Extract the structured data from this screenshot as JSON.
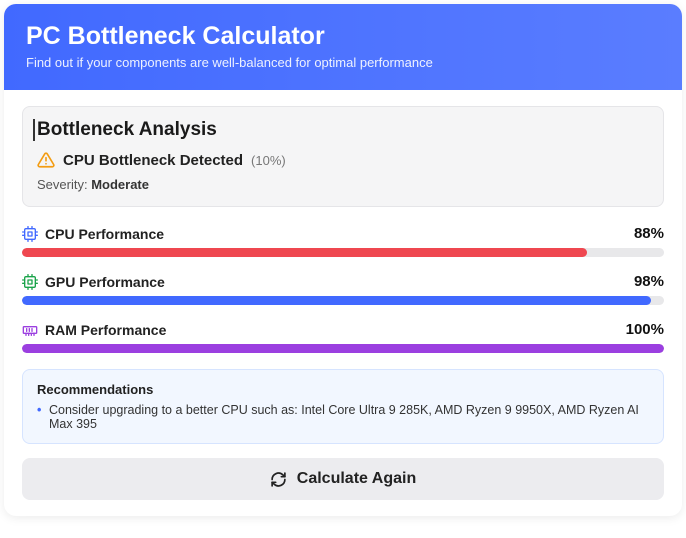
{
  "header": {
    "title": "PC Bottleneck Calculator",
    "subtitle": "Find out if your components are well-balanced for optimal performance"
  },
  "analysis": {
    "heading": "Bottleneck Analysis",
    "detected_label": "CPU Bottleneck Detected",
    "detected_pct": "(10%)",
    "severity_label": "Severity:",
    "severity_value": "Moderate"
  },
  "perf": {
    "cpu": {
      "label": "CPU Performance",
      "value": "88%",
      "width": "88%"
    },
    "gpu": {
      "label": "GPU Performance",
      "value": "98%",
      "width": "98%"
    },
    "ram": {
      "label": "RAM Performance",
      "value": "100%",
      "width": "100%"
    }
  },
  "recs": {
    "heading": "Recommendations",
    "item": "Consider upgrading to a better CPU such as: Intel Core Ultra 9 285K, AMD Ryzen 9 9950X, AMD Ryzen AI Max 395"
  },
  "button": {
    "label": "Calculate Again"
  }
}
